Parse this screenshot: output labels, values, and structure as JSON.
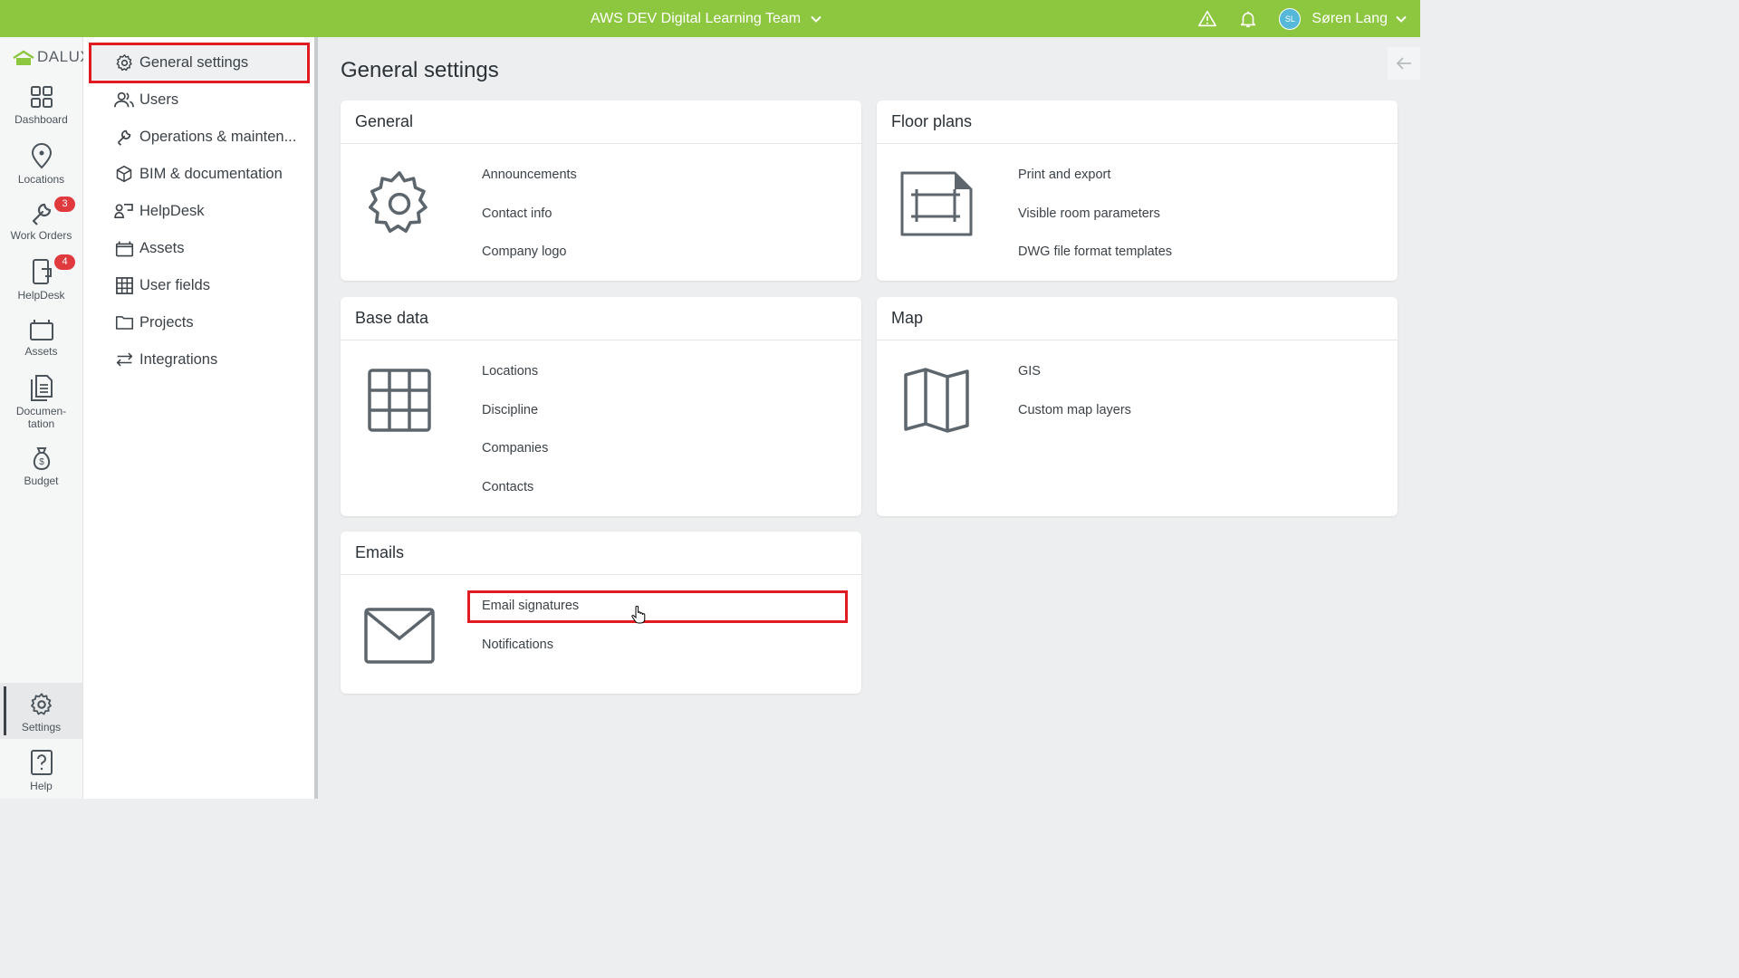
{
  "topbar": {
    "team": "AWS DEV Digital Learning Team",
    "user_initials": "SL",
    "user_name": "Søren Lang",
    "color": "#8dc63f"
  },
  "rail": {
    "logo": "DALUX",
    "items": [
      {
        "label": "Dashboard",
        "icon": "grid-icon"
      },
      {
        "label": "Locations",
        "icon": "location-pin-icon"
      },
      {
        "label": "Work Orders",
        "icon": "wrench-icon",
        "badge": "3"
      },
      {
        "label": "HelpDesk",
        "icon": "helpdesk-icon",
        "badge": "4"
      },
      {
        "label": "Assets",
        "icon": "assets-icon"
      },
      {
        "label": "Documen-\ntation",
        "icon": "document-icon"
      },
      {
        "label": "Budget",
        "icon": "money-bag-icon"
      }
    ],
    "settings": "Settings",
    "help": "Help"
  },
  "subnav": {
    "items": [
      {
        "label": "General settings",
        "icon": "gear-icon"
      },
      {
        "label": "Users",
        "icon": "users-icon"
      },
      {
        "label": "Operations & mainten...",
        "icon": "wrench-icon"
      },
      {
        "label": "BIM & documentation",
        "icon": "cube-icon"
      },
      {
        "label": "HelpDesk",
        "icon": "helpdesk-icon"
      },
      {
        "label": "Assets",
        "icon": "assets-icon"
      },
      {
        "label": "User fields",
        "icon": "table-icon"
      },
      {
        "label": "Projects",
        "icon": "folder-icon"
      },
      {
        "label": "Integrations",
        "icon": "arrows-icon"
      }
    ]
  },
  "main": {
    "title": "General settings",
    "cards": {
      "general": {
        "title": "General",
        "links": [
          "Announcements",
          "Contact info",
          "Company logo"
        ]
      },
      "floor_plans": {
        "title": "Floor plans",
        "links": [
          "Print and export",
          "Visible room parameters",
          "DWG file format templates"
        ]
      },
      "base_data": {
        "title": "Base data",
        "links": [
          "Locations",
          "Discipline",
          "Companies",
          "Contacts"
        ]
      },
      "map": {
        "title": "Map",
        "links": [
          "GIS",
          "Custom map layers"
        ]
      },
      "emails": {
        "title": "Emails",
        "links": [
          "Email signatures",
          "Notifications"
        ]
      }
    }
  },
  "highlight_color": "#e01b22"
}
